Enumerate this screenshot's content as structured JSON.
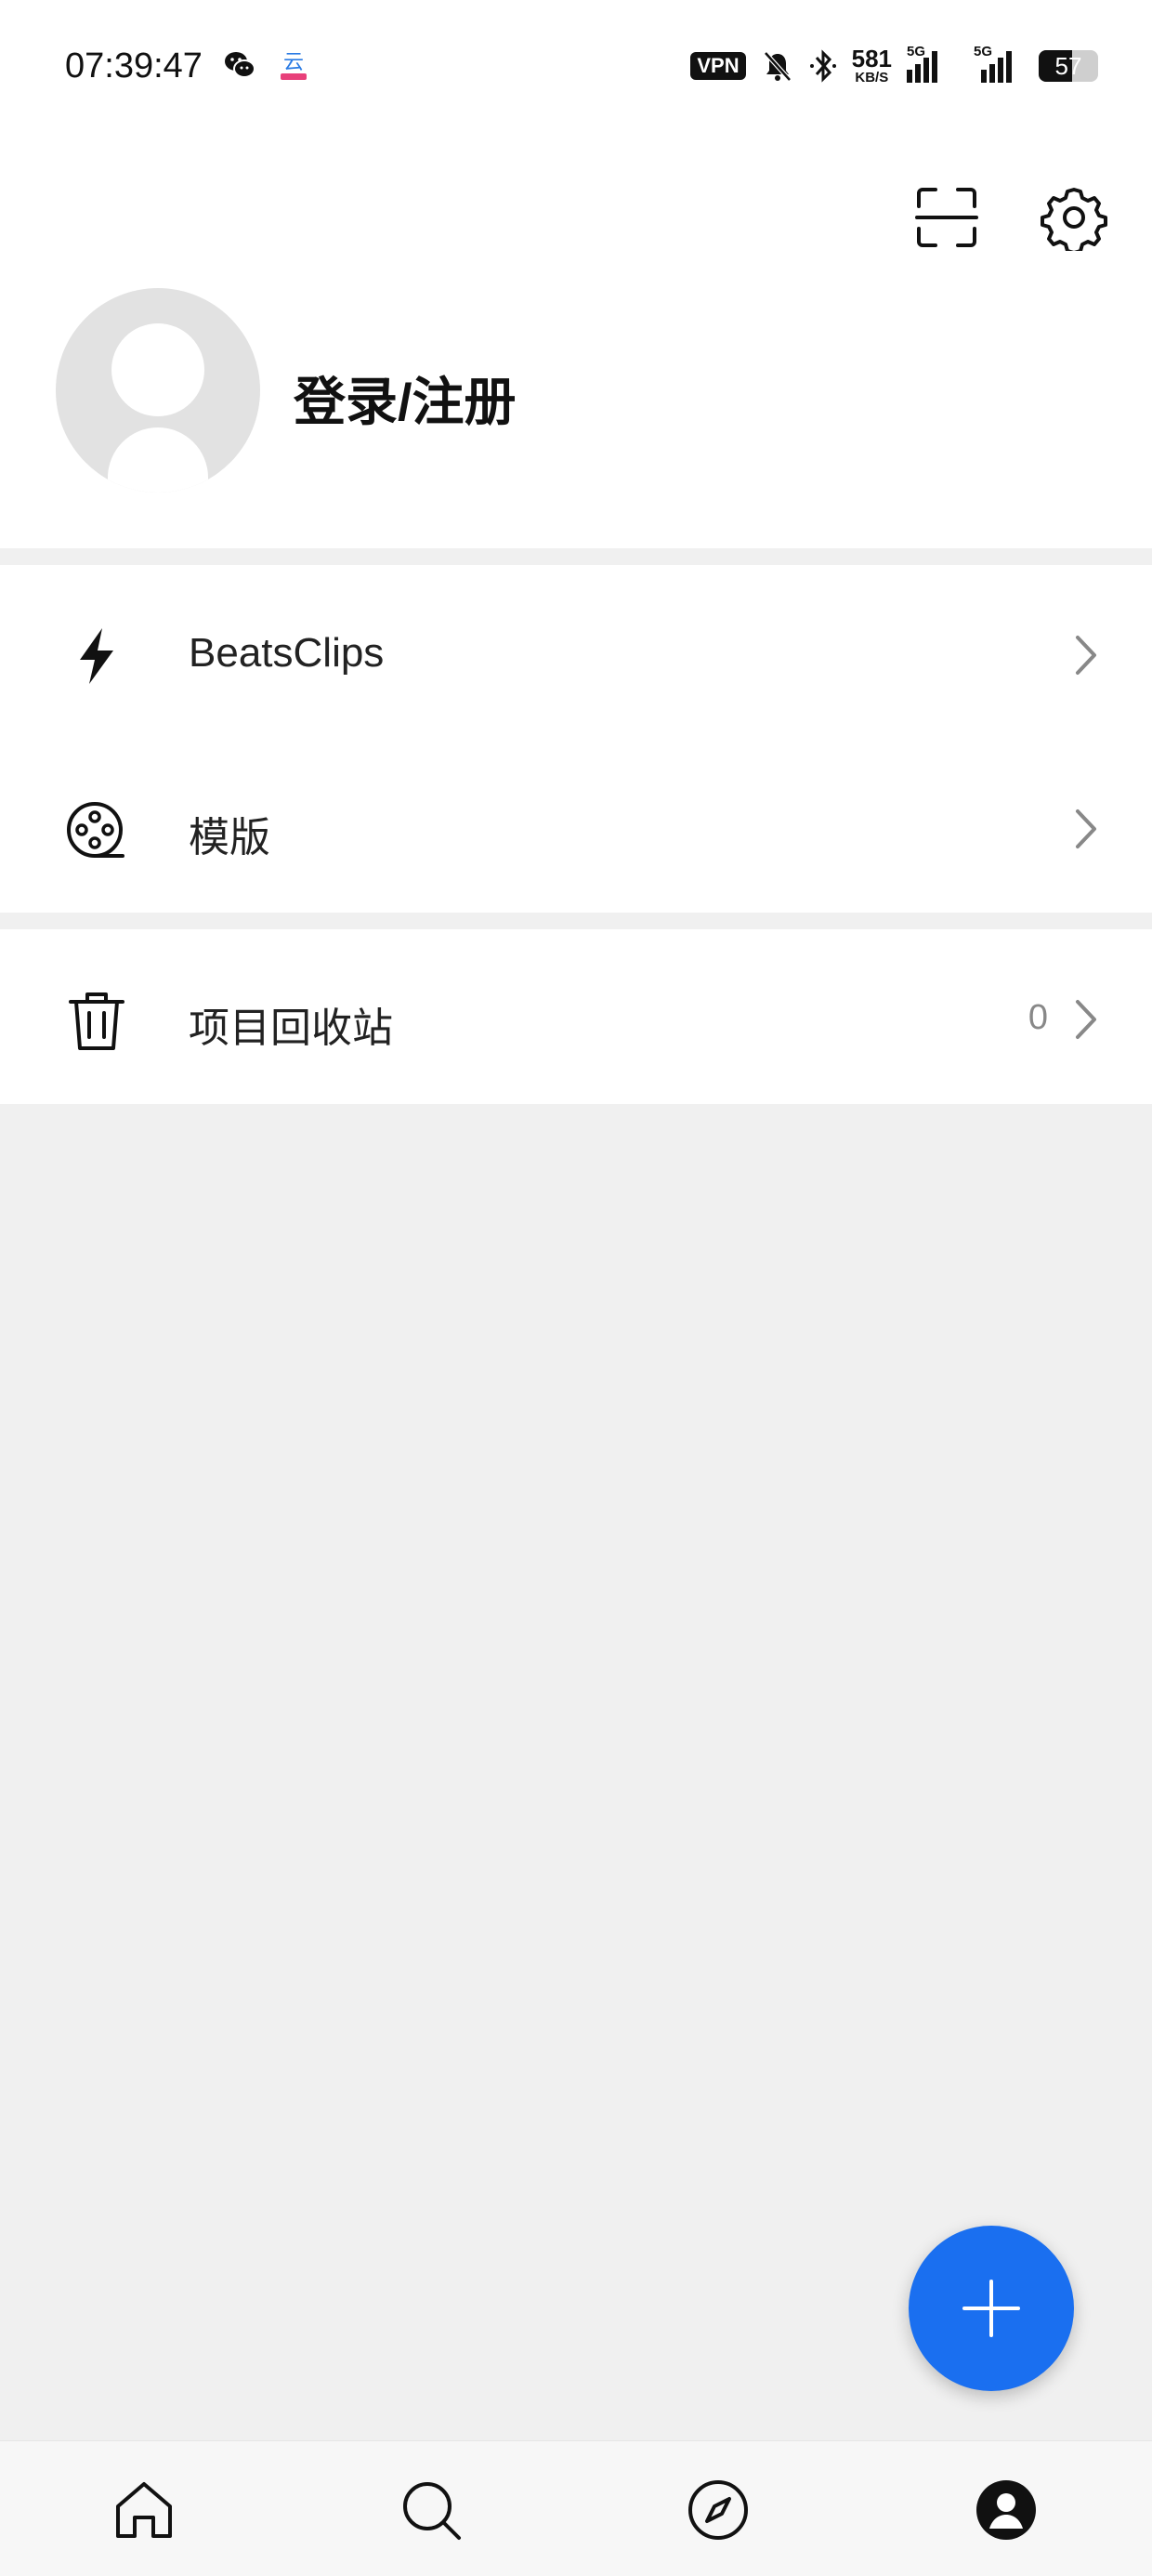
{
  "status_bar": {
    "time": "07:39:47",
    "vpn_label": "VPN",
    "net_speed_value": "581",
    "net_speed_unit": "KB/S",
    "signal_1_label": "5G",
    "signal_2_label": "5G",
    "battery_level": "57",
    "icons": [
      "wechat-icon",
      "app-notification-icon",
      "mute-bell-icon",
      "bluetooth-icon",
      "signal-icon",
      "battery-icon"
    ]
  },
  "header": {
    "login_label": "登录/注册",
    "icons": [
      "scan-icon",
      "gear-icon",
      "avatar-placeholder-icon"
    ]
  },
  "menu": {
    "items": [
      {
        "label": "BeatsClips",
        "icon": "lightning-icon",
        "count": ""
      },
      {
        "label": "模版",
        "icon": "film-reel-icon",
        "count": ""
      },
      {
        "label": "项目回收站",
        "icon": "trash-icon",
        "count": "0"
      }
    ]
  },
  "fab": {
    "icon": "plus-icon",
    "color": "#1a6ff0"
  },
  "bottom_nav": {
    "items": [
      {
        "name": "home",
        "icon": "home-icon"
      },
      {
        "name": "search",
        "icon": "search-icon"
      },
      {
        "name": "discover",
        "icon": "compass-icon"
      },
      {
        "name": "profile",
        "icon": "profile-icon",
        "active": true
      }
    ]
  },
  "colors": {
    "accent": "#1a6ff0",
    "background": "#f0f0f0",
    "surface": "#ffffff"
  }
}
